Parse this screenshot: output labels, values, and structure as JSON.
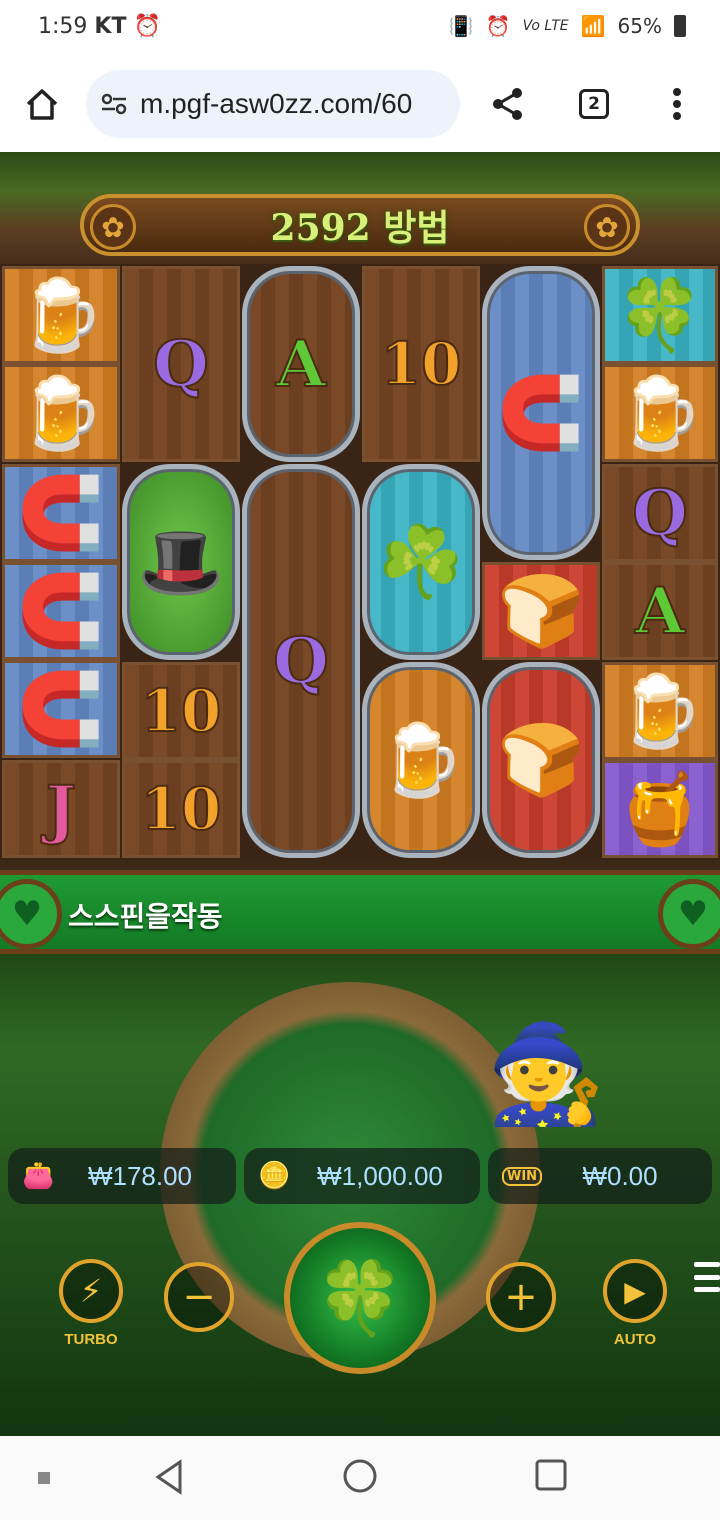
{
  "status_bar": {
    "time": "1:59",
    "carrier": "KT",
    "alarm_icon": "alarm-icon",
    "volte": "Vo LTE",
    "battery": "65%"
  },
  "browser": {
    "url": "m.pgf-asw0zz.com/60",
    "tab_count": "2"
  },
  "game": {
    "ways_label": "2592 방법",
    "ribbon_text": "스스핀을작동",
    "balance": "₩178.00",
    "bet": "₩1,000.00",
    "win": "₩0.00",
    "turbo_label": "TURBO",
    "auto_label": "AUTO",
    "win_badge": "WIN",
    "symbols": {
      "q": "Q",
      "a": "A",
      "ten": "10",
      "j": "J"
    }
  },
  "colors": {
    "accent_gold": "#f2c23a",
    "ways_green": "#d8f07a",
    "ribbon_green": "#1f9a33",
    "value_blue": "#aee0ff"
  }
}
